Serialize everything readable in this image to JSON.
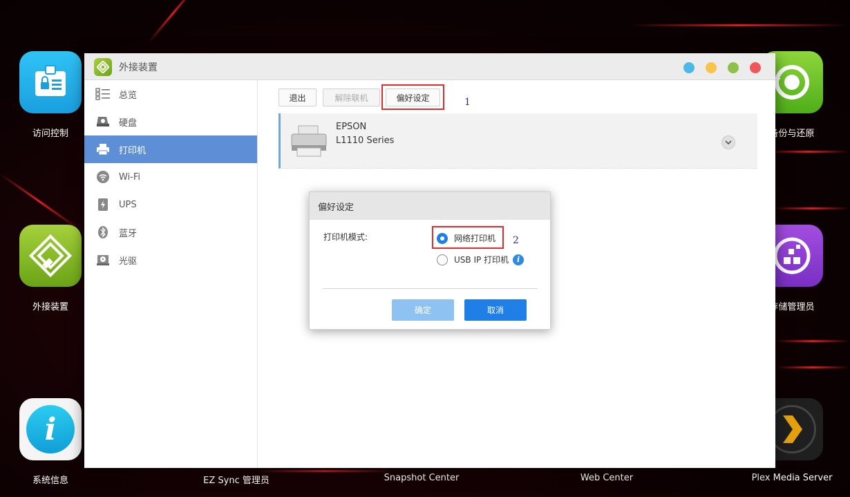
{
  "desktop": {
    "icons": [
      {
        "label": "访问控制"
      },
      {
        "label": "外接装置"
      },
      {
        "label": "系统信息"
      },
      {
        "label": "EZ Sync 管理员"
      },
      {
        "label": "Snapshot Center"
      },
      {
        "label": "Web Center"
      },
      {
        "label": "备份与还原"
      },
      {
        "label": "存储管理员"
      },
      {
        "label": "Plex Media Server"
      }
    ]
  },
  "window": {
    "title": "外接装置",
    "controls": {
      "colors": [
        "#4cb8e6",
        "#f7c54c",
        "#8fc14a",
        "#f0575a"
      ]
    }
  },
  "sidebar": {
    "items": [
      {
        "label": "总览",
        "icon": "overview-list-icon"
      },
      {
        "label": "硬盘",
        "icon": "hard-disk-icon"
      },
      {
        "label": "打印机",
        "icon": "printer-icon",
        "active": true
      },
      {
        "label": "Wi-Fi",
        "icon": "wifi-icon"
      },
      {
        "label": "UPS",
        "icon": "ups-battery-icon"
      },
      {
        "label": "蓝牙",
        "icon": "bluetooth-icon"
      },
      {
        "label": "光驱",
        "icon": "optical-drive-icon"
      }
    ]
  },
  "toolbar": {
    "exit_label": "退出",
    "disconnect_label": "解除联机",
    "preferences_label": "偏好设定"
  },
  "annotations": {
    "step1": "1",
    "step2": "2"
  },
  "device": {
    "brand": "EPSON",
    "model": "L1110 Series"
  },
  "dialog": {
    "title": "偏好设定",
    "mode_label": "打印机模式:",
    "options": [
      {
        "label": "网络打印机",
        "checked": true
      },
      {
        "label": "USB IP 打印机",
        "checked": false
      }
    ],
    "ok_label": "确定",
    "cancel_label": "取消"
  },
  "colors": {
    "accent": "#1f7fe6",
    "nav_active": "#5e8fd6",
    "highlight_box": "#e32b2b"
  }
}
